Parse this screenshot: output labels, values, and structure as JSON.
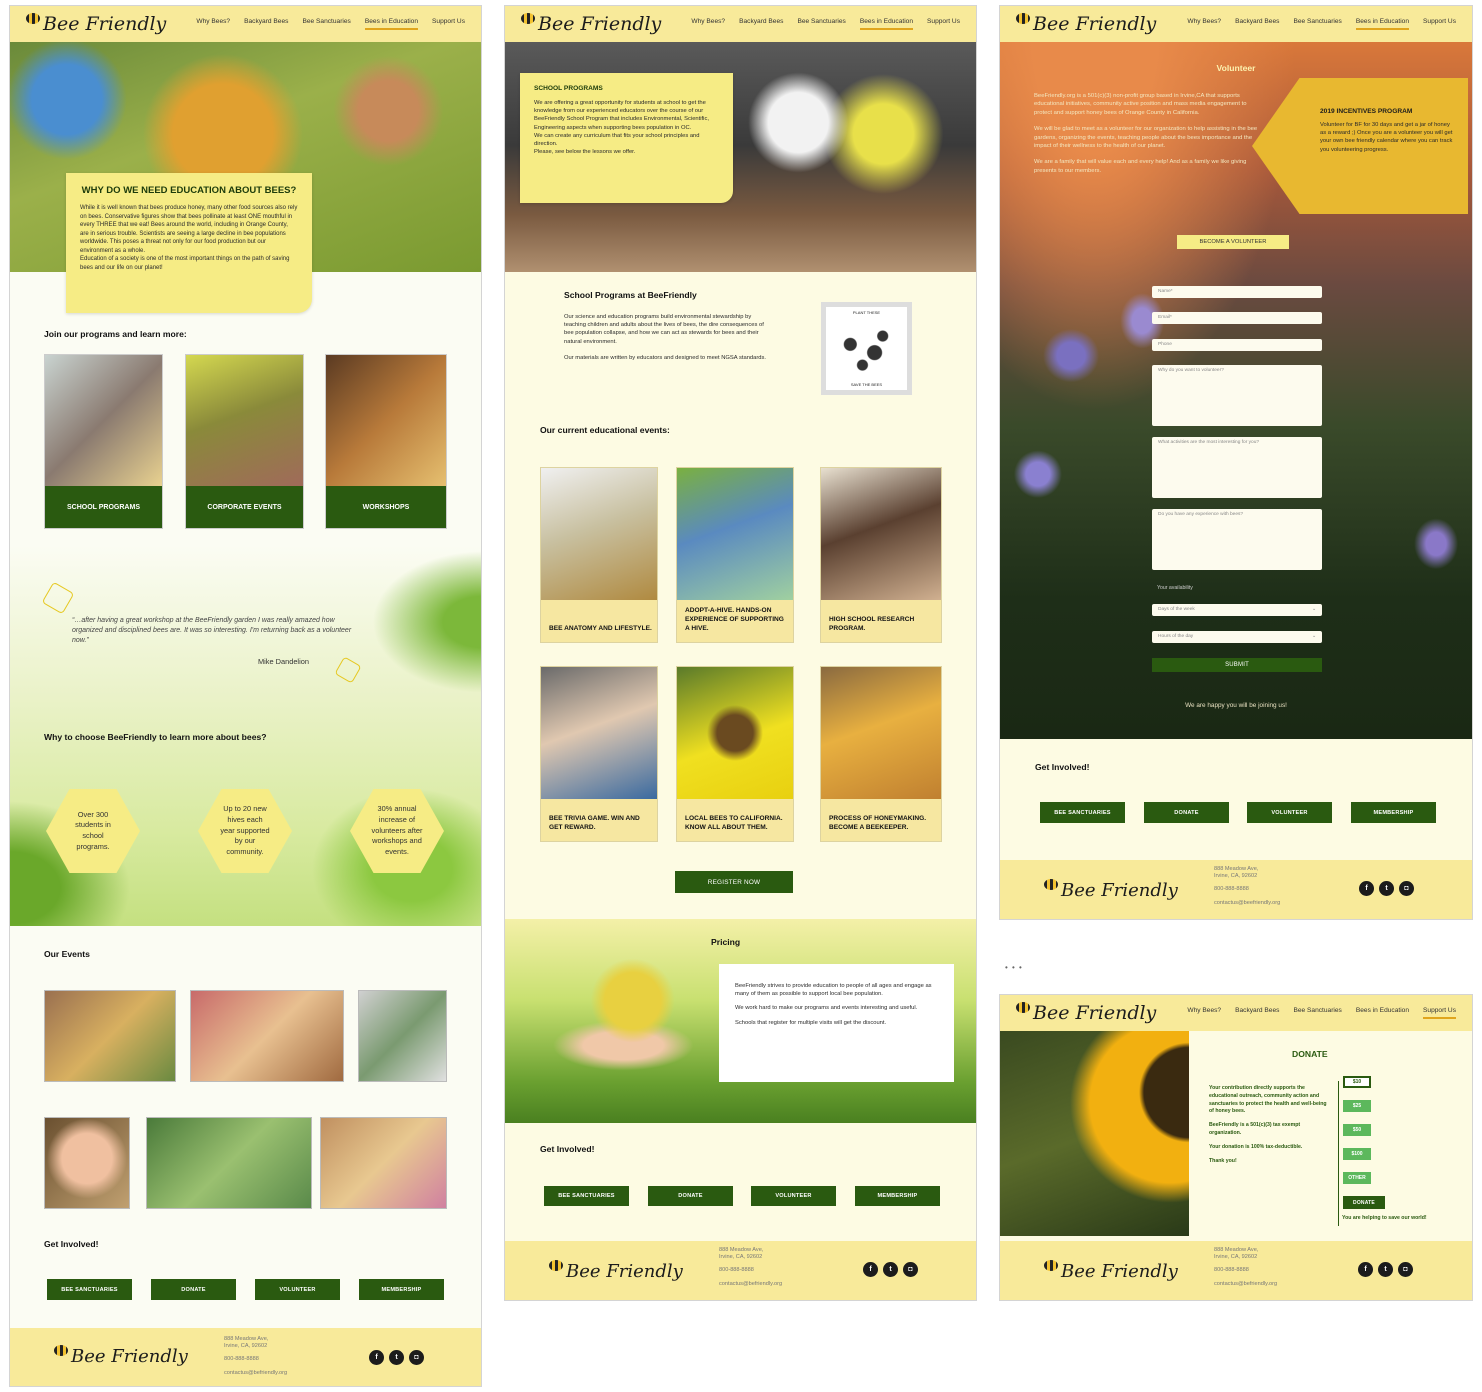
{
  "brand": "Bee Friendly",
  "nav": [
    "Why Bees?",
    "Backyard Bees",
    "Bee Sanctuaries",
    "Bees in Education",
    "Support Us"
  ],
  "footer": {
    "address1": "888 Meadow Ave,",
    "address2": "Irvine, CA, 92602",
    "phone": "800-888-8888",
    "email": "contactus@befriendly.org",
    "email_alt": "contactus@beefriendly.org"
  },
  "get_involved": {
    "title": "Get Involved!",
    "buttons": [
      "BEE SANCTUARIES",
      "DONATE",
      "VOLUNTEER",
      "MEMBERSHIP"
    ]
  },
  "page1": {
    "why_title": "WHY DO WE NEED EDUCATION ABOUT BEES?",
    "why_text": "While it is well known that bees produce honey, many other food sources also rely on bees. Conservative figures show that bees pollinate at least ONE mouthful in every THREE that we eat! Bees around the world, including in Orange County, are in serious trouble.  Scientists are seeing a large decline in bee populations worldwide. This poses a threat not only for our food production but our environment as a whole.",
    "why_text2": "Education of a society is one of the most important things on the path of saving bees and our life on our planet!",
    "join_title": "Join our programs and learn more:",
    "programs": [
      "SCHOOL PROGRAMS",
      "CORPORATE EVENTS",
      "WORKSHOPS"
    ],
    "quote": "“…after having a great workshop at the BeeFriendly garden I was really amazed how organized and disciplined bees are. It was so interesting. I'm returning back as a volunteer now.”",
    "quote_author": "Mike Dandelion",
    "choose_title": "Why to choose BeeFriendly to learn more about bees?",
    "stats": [
      "Over 300 students in school programs.",
      "Up to 20 new hives each year supported by our community.",
      "30% annual increase of volunteers after workshops and events."
    ],
    "events_title": "Our Events"
  },
  "page2": {
    "hero_title": "SCHOOL PROGRAMS",
    "hero_text": "We are offering a great opportunity for students at school to get the knowledge from our experienced educators over the course of our BeeFriendly School Program that includes Environmental, Scientific, Engineering aspects when supporting bees population in OC.",
    "hero_text2": "We can create any curriculum that fits your school principles and direction.",
    "hero_text3": "Please, see below the lessons we offer.",
    "sp_title": "School Programs at BeeFriendly",
    "sp_text": "Our science and education programs build environmental stewardship by teaching children and adults about the lives of bees, the dire consequences of bee population collapse, and how we can act as stewards for bees and their natural environment.",
    "sp_text2": "Our materials are written by educators and designed to meet NGSA standards.",
    "poster_top": "PLANT THESE",
    "poster_bottom": "SAVE THE BEES",
    "events_title": "Our current educational events:",
    "events": [
      "BEE ANATOMY AND LIFESTYLE.",
      "ADOPT-A-HIVE. HANDS-ON EXPERIENCE OF SUPPORTING A HIVE.",
      "HIGH SCHOOL RESEARCH PROGRAM.",
      "BEE TRIVIA GAME. WIN AND GET REWARD.",
      "LOCAL BEES TO CALIFORNIA. KNOW ALL ABOUT THEM.",
      "PROCESS OF HONEYMAKING. BECOME A BEEKEEPER."
    ],
    "register": "REGISTER NOW",
    "pricing_title": "Pricing",
    "pricing1": "BeeFriendly strives to provide education to people of all ages and engage as many of them as possible to support local bee population.",
    "pricing2": "We work hard to make our programs and events interesting and useful.",
    "pricing3": "Schools that register for multiple visits will get the discount."
  },
  "page3": {
    "title": "Volunteer",
    "text1": "BeeFriendly.org is a 501(c)(3) non-profit group based in Irvine,CA that supports educational initiatives, community active position and mass media engagement to protect and support honey bees of Orange County in California.",
    "text2": "We will be glad to meet as a volunteer for our organization to help assisting in the bee gardens, organizing the events, teaching people about the bees importance and the impact of their wellness to the health of our planet.",
    "text3": "We are a family that will value each and every help! And as a family we like giving presents to our members.",
    "incentive_title": "2019 INCENTIVES PROGRAM",
    "incentive_text": "Volunteer for BF for 30 days and get a jar of honey as a reward ;) Once you are a volunteer you will get your own bee friendly  calendar where you can track you volunteering progress.",
    "become": "BECOME A VOLUNTEER",
    "fields": [
      "Name*",
      "Email*",
      "Phone",
      "Why do you want to volunteer?",
      "What activities are the most interesting for you?",
      "Do you have any experience with bees?"
    ],
    "availability": "Your availability",
    "days": "Days of the week",
    "hours": "Hours of the day",
    "submit": "SUBMIT",
    "thanks": "We are happy you will be joining us!"
  },
  "page4": {
    "title": "DONATE",
    "text1": "Your contribution directly supports the educational outreach, community action and sanctuaries to protect the health and well-being of honey bees.",
    "text2": "BeeFriendly is a 501(c)(3) tax exempt organization.",
    "text3": "Your donation is 100% tax-deductible.",
    "text4": "Thank you!",
    "amounts": [
      "$10",
      "$25",
      "$50",
      "$100",
      "OTHER"
    ],
    "donate": "DONATE",
    "helping": "You are helping to save our world!"
  },
  "ellipsis": "• • •",
  "colors": {
    "accent": "#f6ec85",
    "dark_green": "#2a5a10",
    "nav_yellow": "#f8ea9a",
    "underline": "#e0a51c"
  }
}
